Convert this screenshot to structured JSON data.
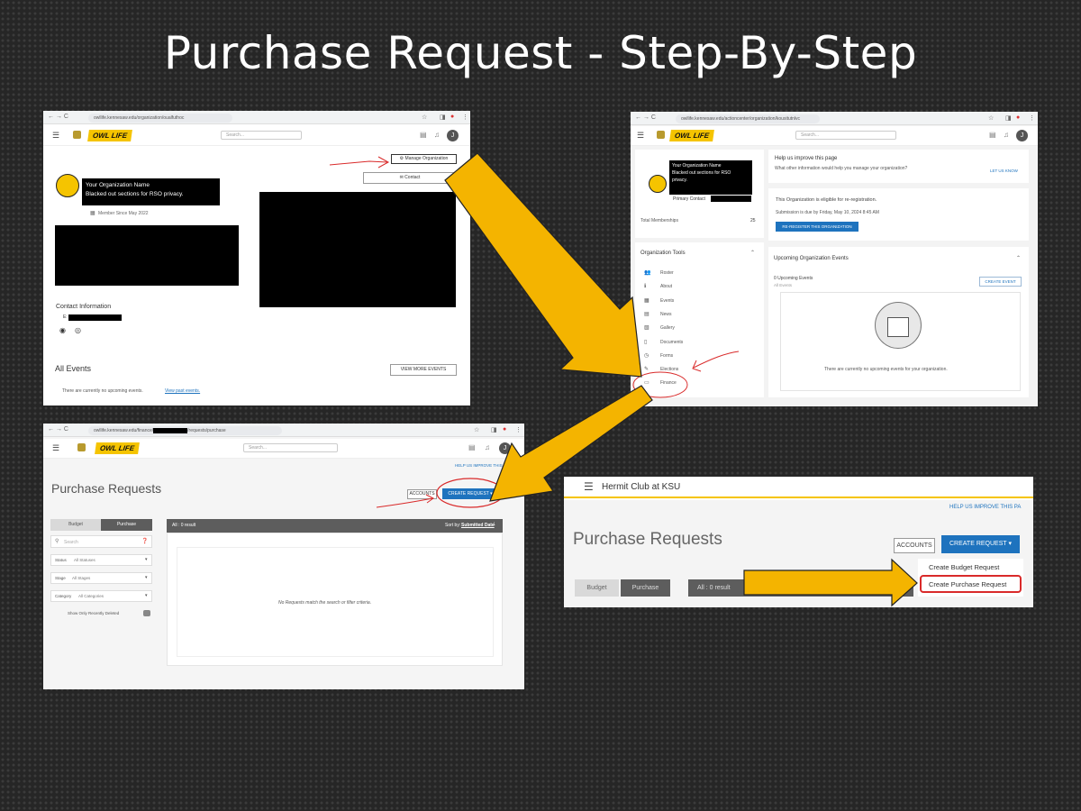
{
  "slide": {
    "title": "Purchase Request - Step-By-Step"
  },
  "colors": {
    "accent": "#f5c400",
    "arrow": "#f4b400",
    "annotation": "#d92a2a",
    "link": "#1e73be",
    "background": "#262626"
  },
  "common": {
    "logo_text": "OWL LIFE",
    "search_placeholder": "Search...",
    "avatar_initial": "J",
    "nav_icons": "← → C",
    "browser_icons": [
      "star-icon",
      "sidepanel-icon",
      "profile-icon",
      "menu-icon"
    ]
  },
  "shot1": {
    "url": "owllife.kennesaw.edu/organization/oualfuthoc",
    "search_placeholder": "Search...",
    "manage_org_label": "Manage Organization",
    "contact_label": "Contact",
    "org_name_line1": "Your Organization Name",
    "org_name_line2": "Blacked out sections for RSO privacy.",
    "member_since": "Member Since May 2022",
    "contact_info_heading": "Contact Information",
    "email_prefix": "E:",
    "all_events_heading": "All Events",
    "view_more_events": "VIEW MORE EVENTS",
    "no_events_text": "There are currently no upcoming events.",
    "view_past_events": "View past events."
  },
  "shot2": {
    "url": "owllife.kennesaw.edu/actioncenter/organization/kousitutnlvc",
    "search_placeholder": "Search...",
    "org_name_line1": "Your Organization Name",
    "org_name_line2": "Blacked out sections for RSO",
    "org_name_line3": "privacy.",
    "primary_contact_label": "Primary Contact",
    "total_memberships_label": "Total Memberships",
    "total_memberships_value": "25",
    "help_heading": "Help us improve this page",
    "help_question": "What other information would help you manage your organization?",
    "let_us_know": "LET US KNOW",
    "eligible_text": "This Organization is eligible for re-registration.",
    "due_text": "Submission is due by Friday, May 10, 2024 8:45 AM",
    "reregister_button": "RE-REGISTER THIS ORGANIZATION",
    "org_tools_heading": "Organization Tools",
    "tools": [
      {
        "label": "Roster",
        "icon": "roster-icon"
      },
      {
        "label": "About",
        "icon": "info-icon"
      },
      {
        "label": "Events",
        "icon": "calendar-icon"
      },
      {
        "label": "News",
        "icon": "news-icon"
      },
      {
        "label": "Gallery",
        "icon": "gallery-icon"
      },
      {
        "label": "Documents",
        "icon": "document-icon"
      },
      {
        "label": "Forms",
        "icon": "forms-icon"
      },
      {
        "label": "Elections",
        "icon": "elections-icon"
      },
      {
        "label": "Finance",
        "icon": "finance-icon"
      }
    ],
    "upcoming_heading": "Upcoming Organization Events",
    "upcoming_count": "0 Upcoming Events",
    "all_events_link": "All Events",
    "create_event_button": "CREATE EVENT",
    "no_upcoming_text": "There are currently no upcoming events for your organization."
  },
  "shot3": {
    "url_prefix": "owllife.kennesaw.edu/finance/",
    "url_suffix": "/requests/purchase",
    "search_placeholder": "Search...",
    "help_link": "HELP US IMPROVE THIS PAGE",
    "page_title": "Purchase Requests",
    "accounts_button": "ACCOUNTS",
    "create_request_button": "CREATE REQUEST ▾",
    "tab_budget": "Budget",
    "tab_purchase": "Purchase",
    "filter_search_placeholder": "Search",
    "status_label": "Status",
    "status_value": "All Statuses",
    "stage_label": "Stage",
    "stage_value": "All Stages",
    "category_label": "Category",
    "category_value": "All Categories",
    "recently_deleted_label": "Show Only Recently Deleted",
    "result_count": "All : 0 result",
    "sort_label": "Sort by:",
    "sort_value": "Submitted Date",
    "empty_text": "No Requests match the search or filter criteria."
  },
  "shot4": {
    "org_title": "Hermit Club at KSU",
    "help_link": "HELP US IMPROVE THIS PA",
    "page_title": "Purchase Requests",
    "accounts_button": "ACCOUNTS",
    "create_request_button": "CREATE REQUEST ▾",
    "menu_budget": "Create Budget Request",
    "menu_purchase": "Create Purchase Request",
    "tab_budget": "Budget",
    "tab_purchase": "Purchase",
    "result_count": "All : 0 result"
  }
}
